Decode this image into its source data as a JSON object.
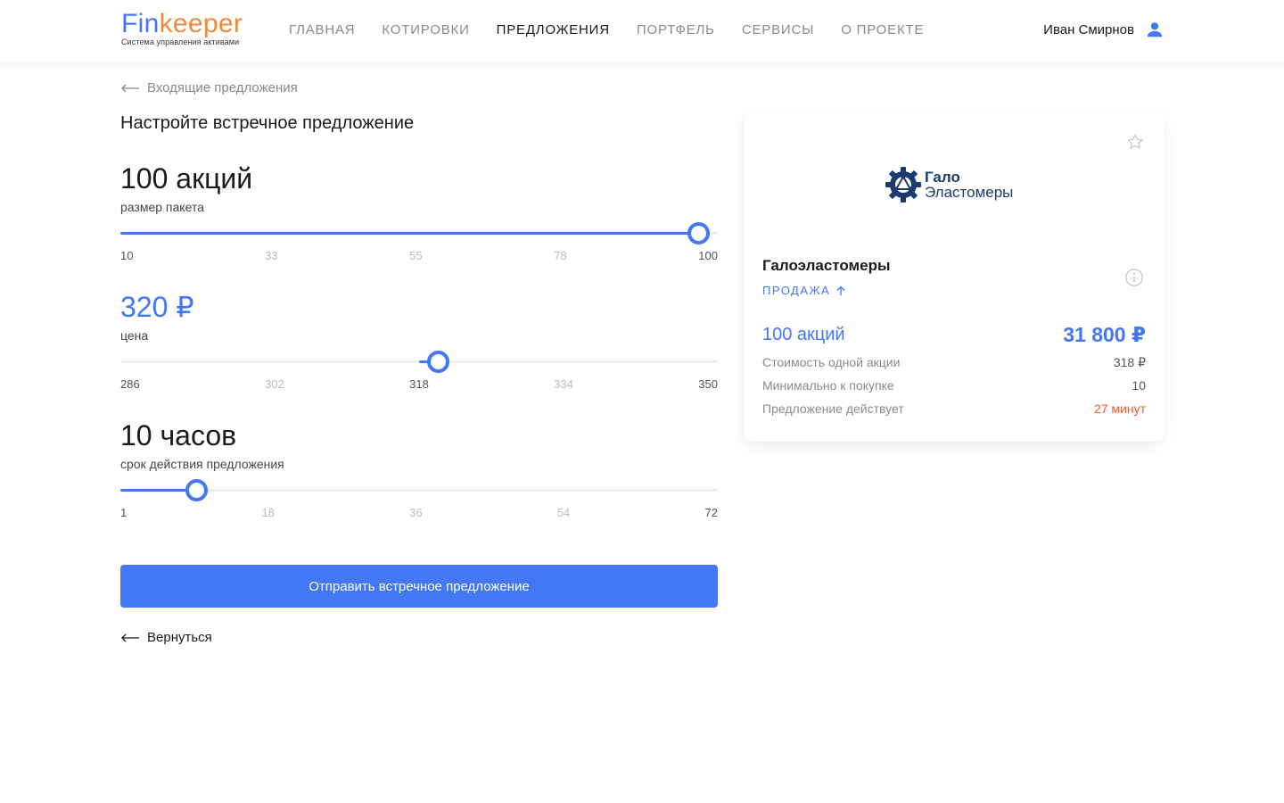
{
  "header": {
    "logo_fin": "Fin",
    "logo_keeper": "keeper",
    "logo_tagline": "Система управления активами",
    "nav": [
      "ГЛАВНАЯ",
      "КОТИРОВКИ",
      "ПРЕДЛОЖЕНИЯ",
      "ПОРТФЕЛЬ",
      "СЕРВИСЫ",
      "О ПРОЕКТЕ"
    ],
    "active_nav": "ПРЕДЛОЖЕНИЯ",
    "user_name": "Иван Смирнов",
    "user_icon": "user-icon"
  },
  "breadcrumb": {
    "label": "Входящие предложения",
    "icon": "arrow-left-icon"
  },
  "page_title": "Настройте встречное предложение",
  "sliders": {
    "size": {
      "value_text": "100 акций",
      "label": "размер пакета",
      "ticks": [
        "10",
        "33",
        "55",
        "78",
        "100"
      ],
      "min": 10,
      "max": 100,
      "value": 97,
      "accent": "#4377f5"
    },
    "price": {
      "value_text": "320 ₽",
      "label": "цена",
      "ticks": [
        "286",
        "302",
        "318",
        "334",
        "350"
      ],
      "min": 286,
      "max": 350,
      "range_from": 318,
      "value": 320
    },
    "duration": {
      "value_text": "10 часов",
      "label": "срок действия предложения",
      "ticks": [
        "1",
        "18",
        "36",
        "54",
        "72"
      ],
      "min": 1,
      "max": 72,
      "value": 10
    }
  },
  "submit_label": "Отправить встречное предложение",
  "back_label": "Вернуться",
  "offer_card": {
    "logo_line1": "Гало",
    "logo_line2": "Эластомеры",
    "company_name": "Галоэластомеры",
    "deal_type": "ПРОДАЖА",
    "quantity": "100 акций",
    "total": "31 800 ₽",
    "rows": [
      {
        "key": "Стоимость одной акции",
        "value": "318 ₽"
      },
      {
        "key": "Минимально к покупке",
        "value": "10"
      },
      {
        "key": "Предложение действует",
        "value": "27 минут"
      }
    ],
    "icons": [
      "star-icon",
      "info-icon",
      "arrow-up-icon"
    ],
    "colors": {
      "accent": "#4377f5",
      "expiry": "#f05a28",
      "logo": "#1a3b6b"
    }
  }
}
